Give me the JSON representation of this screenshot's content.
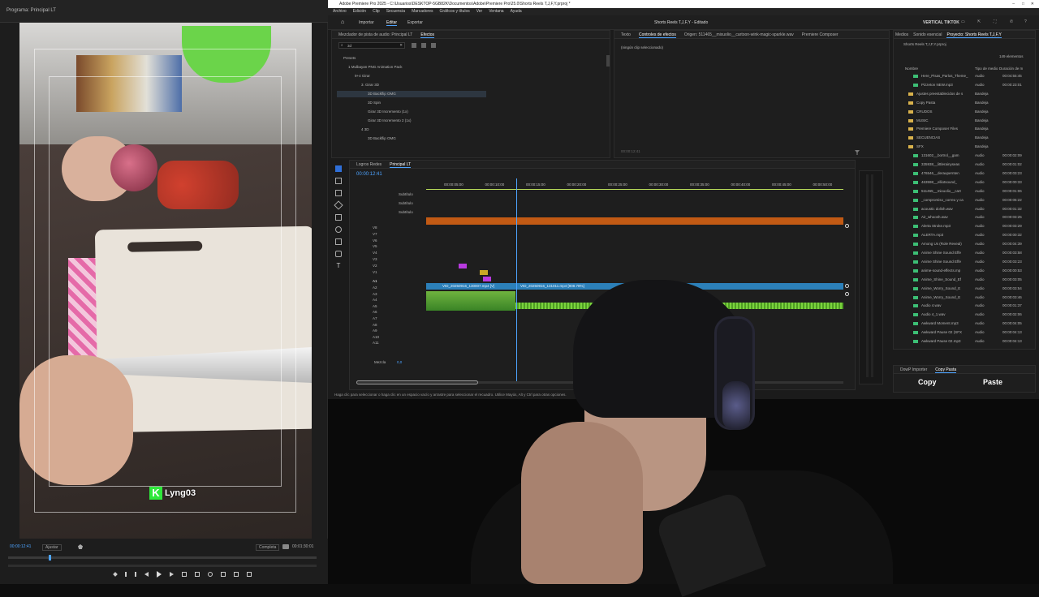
{
  "left_monitor": {
    "tab": "Programa: Principal LT",
    "timecode_left": "00:00:12:41",
    "fit": "Ajustar",
    "quality": "Completa",
    "timecode_right": "00:01:30:01",
    "watermark": "Lyng03"
  },
  "premiere": {
    "window_title": "Adobe Premiere Pro 2025 - C:\\Usuarios\\DESKTOP-5GB82K\\Documentos\\Adobe\\Premiere Pro\\25.0\\Shorts Reels T,J,F,Y.prproj *",
    "menu": [
      "Archivo",
      "Edición",
      "Clip",
      "Secuencia",
      "Marcadores",
      "Gráficos y títulos",
      "Ver",
      "Ventana",
      "Ayuda"
    ],
    "header_tabs": [
      "Importar",
      "Editar",
      "Exportar"
    ],
    "project_title": "Shorts Reels T,J,F,Y - Editado",
    "workspace": "VERTICAL TIKTOK",
    "effects_panel": {
      "tabs": [
        "Mezclador de pista de audio: Principal LT",
        "Efectos"
      ],
      "search": "3d",
      "tree": [
        "Presets",
        "1 Mulbayan PNG Animation Pack",
        "9+4 Girar",
        "3. Girar 3D",
        "3D Backflip OMG",
        "3D Spin",
        "Girar 3D Incremento (1x)",
        "Girar 3D Incremento 2 (1x)",
        "4 3D",
        "3D Backflip OMG"
      ]
    },
    "effect_controls": {
      "tabs": [
        "Texto",
        "Controles de efectos",
        "Origen: 511465__mixuolio__cartoon-wink-magic-sparkle.wav",
        "Premiere Composer"
      ],
      "empty": "(ningún clip seleccionado)",
      "timecode": "00:00:12:41"
    },
    "project_panel": {
      "tabs": [
        "Medios",
        "Sonido esencial",
        "Proyecto: Shorts Reels T,J,F,Y"
      ],
      "path": "Shorts Reels T,J,F,Y.prproj",
      "count": "149 elementos",
      "columns": [
        "Nombre",
        "Tipo de medio",
        "Duración de m"
      ],
      "items": [
        {
          "name": "Here_Pisas_Parlos_Theme_",
          "type": "Audio",
          "dur": "00:04:55:45"
        },
        {
          "name": "Pizzeton NEW.mp3",
          "type": "Audio",
          "dur": "00:00:23:01"
        },
        {
          "name": "Ajustes preestablecidos de s",
          "type": "Bandeja",
          "dur": ""
        },
        {
          "name": "Copy Pasta",
          "type": "Bandeja",
          "dur": ""
        },
        {
          "name": "CRUDOS",
          "type": "Bandeja",
          "dur": ""
        },
        {
          "name": "MUSIC",
          "type": "Bandeja",
          "dur": ""
        },
        {
          "name": "Premiere Composer Files",
          "type": "Bandeja",
          "dur": ""
        },
        {
          "name": "SECUENCIAS",
          "type": "Bandeja",
          "dur": ""
        },
        {
          "name": "SFX",
          "type": "Bandeja",
          "dur": ""
        },
        {
          "name": "131602__bortrol__gam",
          "type": "Audio",
          "dur": "00:00:02:09"
        },
        {
          "name": "335938__littlerainyseas",
          "type": "Audio",
          "dur": "00:00:01:02"
        },
        {
          "name": "476546__deraupernten",
          "type": "Audio",
          "dur": "00:00:03:23"
        },
        {
          "name": "463598__elliotsound_",
          "type": "Audio",
          "dur": "00:00:00:33"
        },
        {
          "name": "511465__mixuolio__cart",
          "type": "Audio",
          "dur": "00:00:01:06"
        },
        {
          "name": "_compromiso_correo y ca",
          "type": "Audio",
          "dur": "00:00:05:22"
        },
        {
          "name": "acoustic dolish.wav",
          "type": "Audio",
          "dur": "00:00:01:32"
        },
        {
          "name": "Air_whoosh.wav",
          "type": "Audio",
          "dur": "00:00:03:25"
        },
        {
          "name": "Alerta Stroke.mp3",
          "type": "Audio",
          "dur": "00:00:03:29"
        },
        {
          "name": "ALERTA.mp3",
          "type": "Audio",
          "dur": "00:00:00:32"
        },
        {
          "name": "Among Us (Role Reveal)",
          "type": "Audio",
          "dur": "00:00:04:39"
        },
        {
          "name": "Anime Shine Sound Effe",
          "type": "Audio",
          "dur": "00:00:03:58"
        },
        {
          "name": "Anime Shine Sound Effe",
          "type": "Audio",
          "dur": "00:00:03:23"
        },
        {
          "name": "anime-sound-effects.mp",
          "type": "Audio",
          "dur": "00:00:00:53"
        },
        {
          "name": "Anime_Shine_Sound_Ef",
          "type": "Audio",
          "dur": "00:00:03:05"
        },
        {
          "name": "Anime_Worry_Sound_E",
          "type": "Audio",
          "dur": "00:00:03:54"
        },
        {
          "name": "Anime_Worry_Sound_E",
          "type": "Audio",
          "dur": "00:00:03:46"
        },
        {
          "name": "Audio 4.wav",
          "type": "Audio",
          "dur": "00:00:01:37"
        },
        {
          "name": "Audio 4_1.wav",
          "type": "Audio",
          "dur": "00:00:02:06"
        },
        {
          "name": "Awkward Moment.mp3",
          "type": "Audio",
          "dur": "00:00:04:05"
        },
        {
          "name": "Awkward Pause 02 (SFX",
          "type": "Audio",
          "dur": "00:00:04:13"
        },
        {
          "name": "Awkward Pause 02.mp3",
          "type": "Audio",
          "dur": "00:00:04:13"
        }
      ]
    },
    "timeline": {
      "tabs": [
        "Logros Redes",
        "Principal LT"
      ],
      "timecode": "00:00:12:41",
      "ruler": [
        "00:00:05:00",
        "00:00:10:00",
        "00:00:15:00",
        "00:00:20:00",
        "00:00:25:00",
        "00:00:30:00",
        "00:00:35:00",
        "00:00:40:00",
        "00:00:45:00",
        "00:00:50:00"
      ],
      "subtitle_tracks": [
        "Subtítulo",
        "Subtítulo",
        "Subtítulo"
      ],
      "video_tracks": [
        "V8",
        "V7",
        "V6",
        "V5",
        "V4",
        "V3",
        "V2",
        "V1"
      ],
      "audio_tracks": [
        "A1",
        "A2",
        "A3",
        "A4",
        "A5",
        "A6",
        "A7",
        "A8",
        "A9",
        "A10",
        "A11"
      ],
      "mix_label": "Mezcla",
      "mix_value": "0,0",
      "clip1": "VID_20250916_130007.mp4 [V]",
      "clip2": "VID_20250916_131011.mp4 [908.78%]"
    },
    "bottom_panel": {
      "tabs": [
        "DowP Importer",
        "Copy Pasta"
      ],
      "copy": "Copy",
      "paste": "Paste"
    },
    "status": "Haga clic para seleccionar o haga clic en un espacio vacío y arrastre para seleccionar el recuadro. Utilice Mayús, Alt y Ctrl para otras opciones."
  }
}
